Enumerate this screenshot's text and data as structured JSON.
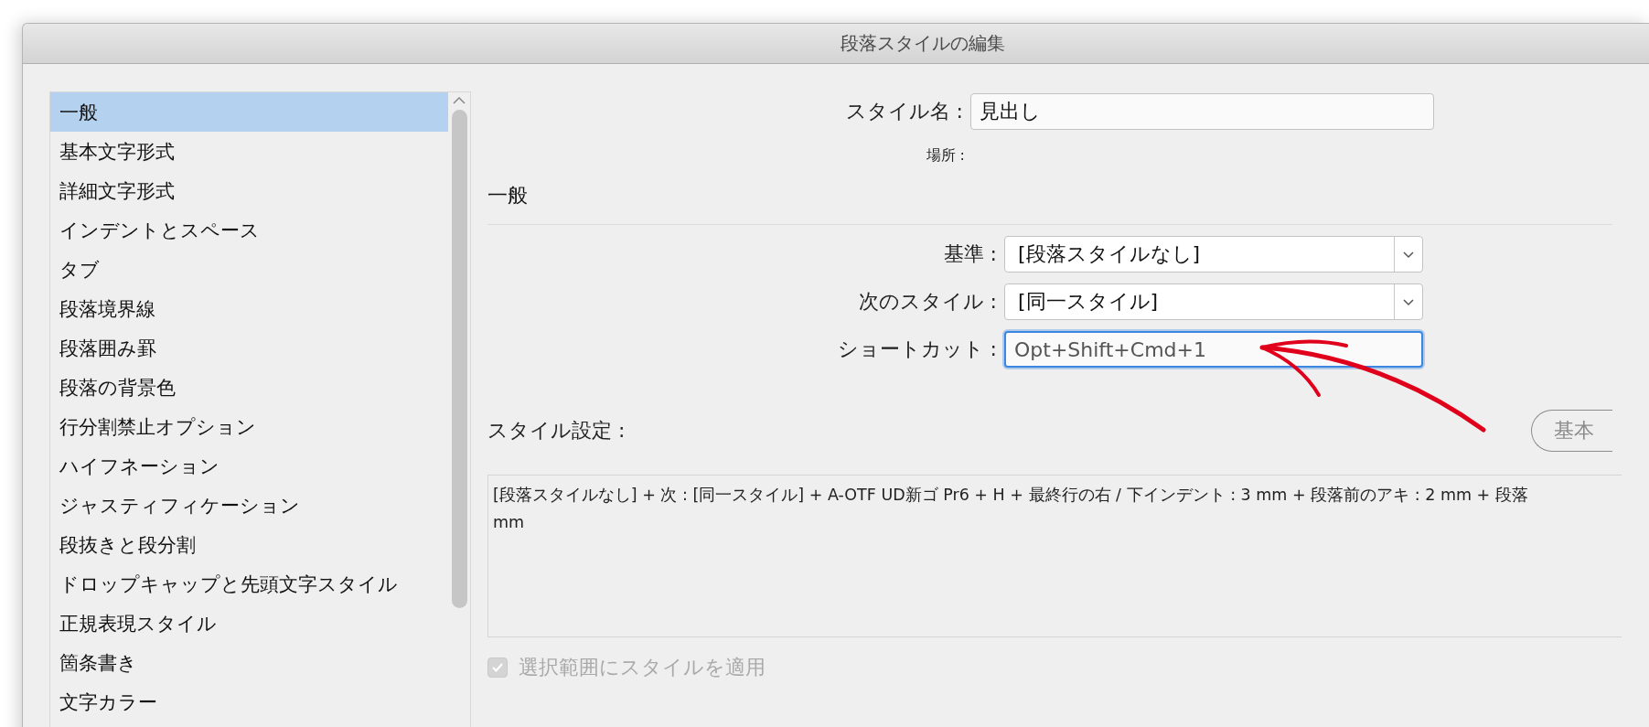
{
  "window": {
    "title": "段落スタイルの編集"
  },
  "sidebar": {
    "items": [
      {
        "label": "一般",
        "selected": true
      },
      {
        "label": "基本文字形式",
        "selected": false
      },
      {
        "label": "詳細文字形式",
        "selected": false
      },
      {
        "label": "インデントとスペース",
        "selected": false
      },
      {
        "label": "タブ",
        "selected": false
      },
      {
        "label": "段落境界線",
        "selected": false
      },
      {
        "label": "段落囲み罫",
        "selected": false
      },
      {
        "label": "段落の背景色",
        "selected": false
      },
      {
        "label": "行分割禁止オプション",
        "selected": false
      },
      {
        "label": "ハイフネーション",
        "selected": false
      },
      {
        "label": "ジャスティフィケーション",
        "selected": false
      },
      {
        "label": "段抜きと段分割",
        "selected": false
      },
      {
        "label": "ドロップキャップと先頭文字スタイル",
        "selected": false
      },
      {
        "label": "正規表現スタイル",
        "selected": false
      },
      {
        "label": "箇条書き",
        "selected": false
      },
      {
        "label": "文字カラー",
        "selected": false
      }
    ]
  },
  "style_name": {
    "label": "スタイル名 :",
    "value": "見出し"
  },
  "location": {
    "label": "場所 :"
  },
  "section_title": "一般",
  "fields": [
    {
      "kind": "select",
      "label": "基準 :",
      "value": "[段落スタイルなし]"
    },
    {
      "kind": "select",
      "label": "次のスタイル :",
      "value": "[同一スタイル]"
    },
    {
      "kind": "input",
      "label": "ショートカット :",
      "value": "Opt+Shift+Cmd+1",
      "focused": true
    }
  ],
  "style_settings": {
    "label": "スタイル設定 :",
    "button": "基本",
    "summary": "[段落スタイルなし] + 次 : [同一スタイル] + A-OTF UD新ゴ Pr6 + H + 最終行の右 / 下インデント : 3 mm + 段落前のアキ : 2 mm + 段落\nmm"
  },
  "apply_checkbox": {
    "label": "選択範囲にスタイルを適用",
    "checked": true,
    "disabled": true
  }
}
